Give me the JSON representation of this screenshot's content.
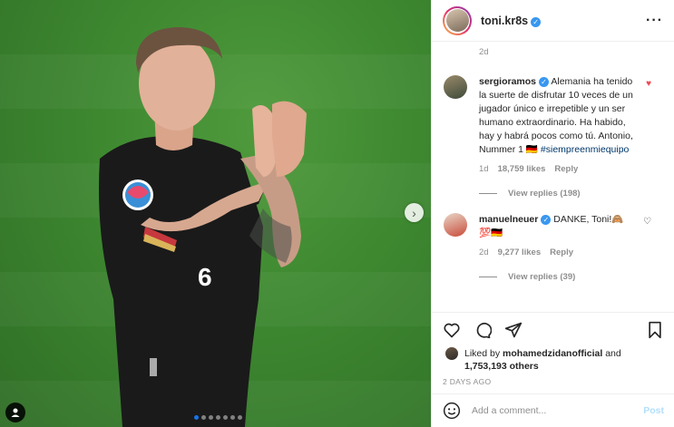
{
  "post": {
    "username": "toni.kr8s",
    "caption_time": "2d"
  },
  "comments": [
    {
      "user": "sergioramos",
      "text": "Alemania ha tenido la suerte de disfrutar 10 veces de un jugador único e irrepetible y un ser humano extraordinario. Ha habido, hay y habrá pocos como tú. Antonio, Nummer 1 🇩🇪 ",
      "hashtag": "#siempreenmiequipo",
      "time": "1d",
      "likes": "18,759 likes",
      "reply": "Reply",
      "view_replies": "View replies (198)"
    },
    {
      "user": "manuelneuer",
      "text": "DANKE, Toni!🙈💯🇩🇪",
      "time": "2d",
      "likes": "9,277 likes",
      "reply": "Reply",
      "view_replies": "View replies (39)"
    }
  ],
  "likes": {
    "prefix": "Liked by",
    "user": "mohamedzidanofficial",
    "joiner": "and",
    "count": "1,753,193 others"
  },
  "time_ago": "2 DAYS AGO",
  "add_comment": {
    "placeholder": "Add a comment...",
    "post_label": "Post"
  },
  "colors": {
    "verified": "#3897f0",
    "hashtag": "#00376b",
    "liked_heart": "#ed4956",
    "post_disabled": "#b2dffc"
  }
}
